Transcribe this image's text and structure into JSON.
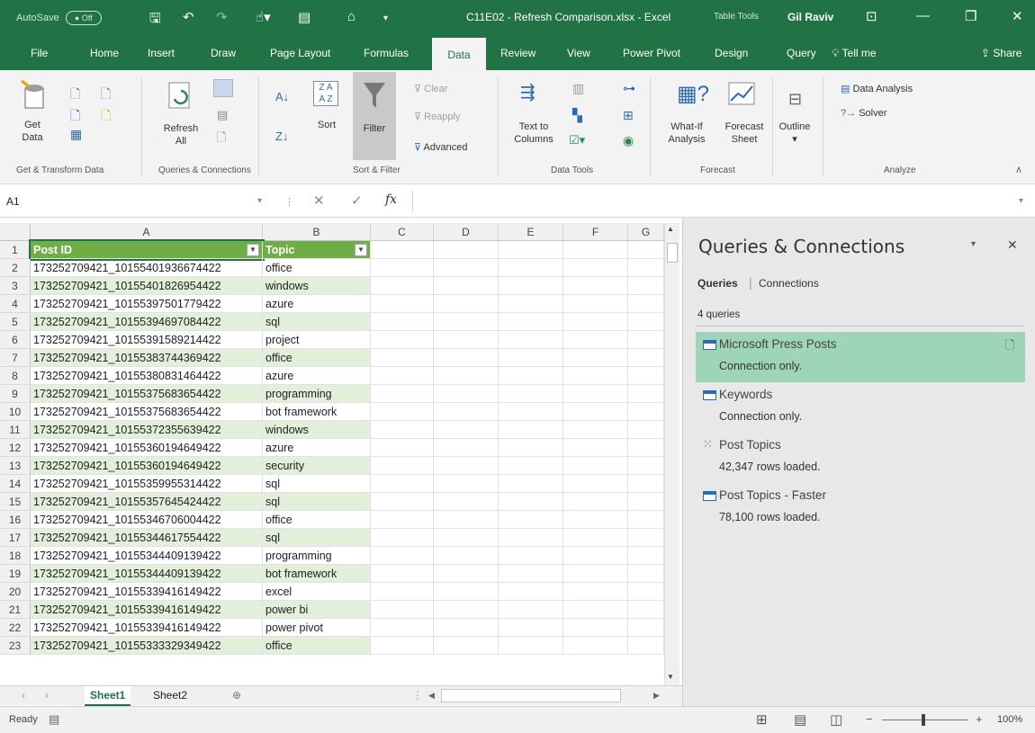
{
  "titlebar": {
    "autosave_label": "AutoSave",
    "autosave_state": "Off",
    "document_title": "C11E02 - Refresh Comparison.xlsx - Excel",
    "context_label": "Table Tools",
    "user_name": "Gil Raviv"
  },
  "tabs": [
    "File",
    "Home",
    "Insert",
    "Draw",
    "Page Layout",
    "Formulas",
    "Data",
    "Review",
    "View",
    "Power Pivot",
    "Design",
    "Query"
  ],
  "active_tab": "Data",
  "tell_me": "Tell me",
  "share": "Share",
  "ribbon": {
    "get_data": "Get\nData",
    "refresh_all": "Refresh\nAll",
    "sort": "Sort",
    "filter": "Filter",
    "clear": "Clear",
    "reapply": "Reapply",
    "advanced": "Advanced",
    "text_to_columns": "Text to\nColumns",
    "what_if": "What-If\nAnalysis",
    "forecast_sheet": "Forecast\nSheet",
    "outline": "Outline",
    "data_analysis": "Data Analysis",
    "solver": "Solver",
    "groups": {
      "get_transform": "Get & Transform Data",
      "queries_connections": "Queries & Connections",
      "sort_filter": "Sort & Filter",
      "data_tools": "Data Tools",
      "forecast": "Forecast",
      "analyze": "Analyze"
    }
  },
  "formula_bar": {
    "name_box": "A1",
    "formula": ""
  },
  "grid": {
    "columns": [
      "A",
      "B",
      "C",
      "D",
      "E",
      "F",
      "G"
    ],
    "header_row": [
      "Post ID",
      "Topic"
    ],
    "rows": [
      [
        "173252709421_10155401936674422",
        "office"
      ],
      [
        "173252709421_10155401826954422",
        "windows"
      ],
      [
        "173252709421_10155397501779422",
        "azure"
      ],
      [
        "173252709421_10155394697084422",
        "sql"
      ],
      [
        "173252709421_10155391589214422",
        "project"
      ],
      [
        "173252709421_10155383744369422",
        "office"
      ],
      [
        "173252709421_10155380831464422",
        "azure"
      ],
      [
        "173252709421_10155375683654422",
        "programming"
      ],
      [
        "173252709421_10155375683654422",
        "bot framework"
      ],
      [
        "173252709421_10155372355639422",
        "windows"
      ],
      [
        "173252709421_10155360194649422",
        "azure"
      ],
      [
        "173252709421_10155360194649422",
        "security"
      ],
      [
        "173252709421_10155359955314422",
        "sql"
      ],
      [
        "173252709421_10155357645424422",
        "sql"
      ],
      [
        "173252709421_10155346706004422",
        "office"
      ],
      [
        "173252709421_10155344617554422",
        "sql"
      ],
      [
        "173252709421_10155344409139422",
        "programming"
      ],
      [
        "173252709421_10155344409139422",
        "bot framework"
      ],
      [
        "173252709421_10155339416149422",
        "excel"
      ],
      [
        "173252709421_10155339416149422",
        "power bi"
      ],
      [
        "173252709421_10155339416149422",
        "power pivot"
      ],
      [
        "173252709421_10155333329349422",
        "office"
      ]
    ]
  },
  "sheets": [
    "Sheet1",
    "Sheet2"
  ],
  "active_sheet": "Sheet1",
  "status": {
    "ready": "Ready",
    "zoom": "100%"
  },
  "queries_pane": {
    "title": "Queries & Connections",
    "tab_queries": "Queries",
    "tab_connections": "Connections",
    "count": "4 queries",
    "items": [
      {
        "name": "Microsoft Press Posts",
        "status": "Connection only."
      },
      {
        "name": "Keywords",
        "status": "Connection only."
      },
      {
        "name": "Post Topics",
        "status": "42,347 rows loaded."
      },
      {
        "name": "Post Topics - Faster",
        "status": "78,100 rows loaded."
      }
    ]
  },
  "colors": {
    "excel_green": "#217346",
    "table_header": "#70ad47",
    "band": "#e2efda",
    "selected_query": "#9fd5b7"
  }
}
